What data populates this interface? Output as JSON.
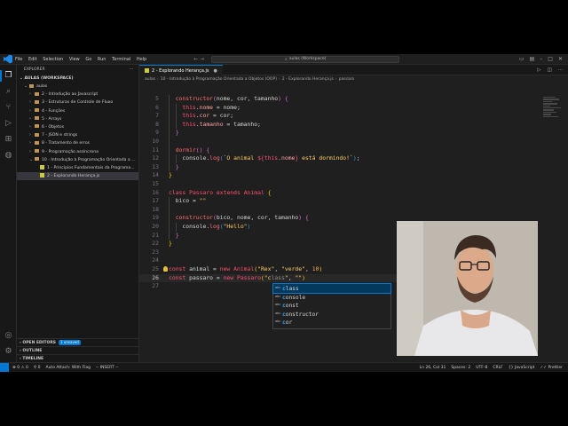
{
  "titlebar": {
    "menu": [
      "File",
      "Edit",
      "Selection",
      "View",
      "Go",
      "Run",
      "Terminal",
      "Help"
    ],
    "search": "aulas (Workspace)"
  },
  "sidebar": {
    "title": "EXPLORER",
    "workspace": "AULAS (WORKSPACE)",
    "root": "aulas",
    "folders": [
      "2 - Introdução ao Javascript",
      "3 - Estruturas de Controle de Fluxo",
      "4 - Funções",
      "5 - Arrays",
      "6 - Objetos",
      "7 - JSON e strings",
      "8 - Tratamento de erros",
      "9 - Programação assíncrona",
      "10 - Introdução à Programação Orientada a ..."
    ],
    "files": [
      "1 - Princípios Fundamentais da Programa...",
      "2 - Explorando Herança.js"
    ],
    "open_editors": "OPEN EDITORS",
    "unsaved_badge": "1 unsaved",
    "outline": "OUTLINE",
    "timeline": "TIMELINE"
  },
  "editor": {
    "tab_label": "2 - Explorando Herança.js",
    "breadcrumb": [
      "aulas",
      "10 - Introdução à Programação Orientada a Objetos (OOP)",
      "2 - Explorando Herança.js",
      "passaro"
    ]
  },
  "code": {
    "line_numbers": [
      "5",
      "6",
      "7",
      "8",
      "9",
      "10",
      "11",
      "12",
      "13",
      "14",
      "15",
      "16",
      "17",
      "18",
      "19",
      "20",
      "21",
      "22",
      "23",
      "24",
      "25",
      "26",
      "27"
    ],
    "current_line": "26"
  },
  "autocomplete": {
    "items": [
      {
        "match": "c",
        "rest": "lass"
      },
      {
        "match": "c",
        "rest": "onsole"
      },
      {
        "match": "c",
        "rest": "onst"
      },
      {
        "match": "c",
        "rest": "onstructor"
      },
      {
        "match": "c",
        "rest": "or"
      }
    ]
  },
  "statusbar": {
    "errors": "0",
    "warnings": "0",
    "ports": "0",
    "autoattach": "Auto Attach: With Flag",
    "mode": "-- INSERT --",
    "position": "Ln 26, Col 31",
    "spaces": "Spaces: 2",
    "encoding": "UTF-8",
    "eol": "CRLF",
    "language": "JavaScript",
    "formatter": "Prettier"
  }
}
